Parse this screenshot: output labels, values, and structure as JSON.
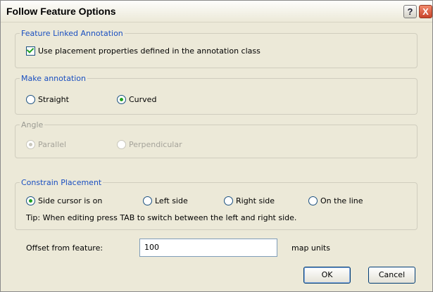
{
  "window": {
    "title": "Follow Feature Options",
    "help_glyph": "?",
    "close_glyph": "X"
  },
  "feature_linked_annotation": {
    "legend": "Feature Linked Annotation",
    "checkbox_label": "Use placement properties defined in the annotation class",
    "checked": true
  },
  "make_annotation": {
    "legend": "Make annotation",
    "options": [
      {
        "label": "Straight",
        "selected": false
      },
      {
        "label": "Curved",
        "selected": true
      }
    ]
  },
  "angle": {
    "legend": "Angle",
    "disabled": true,
    "options": [
      {
        "label": "Parallel",
        "selected": true
      },
      {
        "label": "Perpendicular",
        "selected": false
      }
    ]
  },
  "constrain_placement": {
    "legend": "Constrain Placement",
    "options": [
      {
        "label": "Side cursor is on",
        "selected": true
      },
      {
        "label": "Left side",
        "selected": false
      },
      {
        "label": "Right side",
        "selected": false
      },
      {
        "label": "On the line",
        "selected": false
      }
    ],
    "tip": "Tip:  When editing press TAB to switch between the left and right side."
  },
  "offset": {
    "label": "Offset from feature:",
    "value": "100",
    "units": "map units"
  },
  "buttons": {
    "ok": "OK",
    "cancel": "Cancel"
  }
}
